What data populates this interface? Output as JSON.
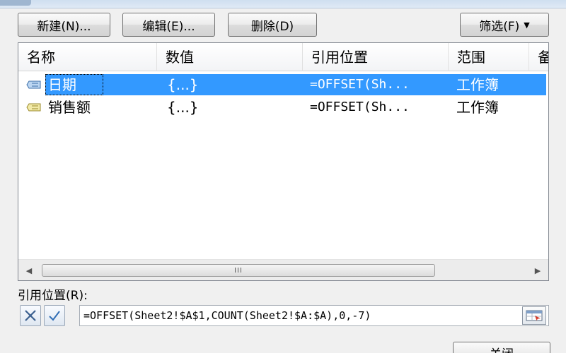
{
  "toolbar": {
    "new_label": "新建(N)...",
    "edit_label": "编辑(E)...",
    "delete_label": "删除(D)",
    "filter_label": "筛选(F)"
  },
  "columns": [
    "名称",
    "数值",
    "引用位置",
    "范围",
    "备"
  ],
  "rows": [
    {
      "name": "日期",
      "value": "{...}",
      "ref": "=OFFSET(Sh...",
      "scope": "工作簿",
      "selected": true
    },
    {
      "name": "销售额",
      "value": "{...}",
      "ref": "=OFFSET(Sh...",
      "scope": "工作簿",
      "selected": false
    }
  ],
  "scrollbar": {
    "thumb_label": "III"
  },
  "ref_section": {
    "label": "引用位置(R):",
    "formula": "=OFFSET(Sheet2!$A$1,COUNT(Sheet2!$A:$A),0,-7)"
  },
  "footer": {
    "close_label": "关闭"
  },
  "colors": {
    "selection": "#3399ff",
    "cancel_x": "#3a5f8f",
    "confirm_check": "#2f6db5"
  }
}
